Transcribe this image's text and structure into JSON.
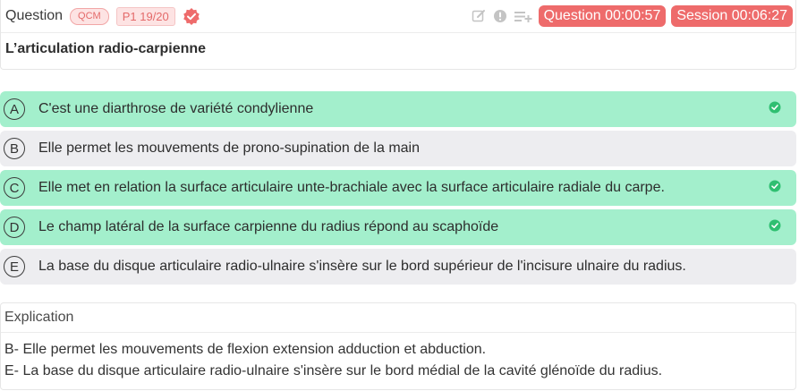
{
  "header": {
    "question_label": "Question",
    "type_badge": "QCM",
    "page_badge": "P1 19/20",
    "question_timer": "Question 00:00:57",
    "session_timer": "Session 00:06:27"
  },
  "question": {
    "title": "L’articulation radio-carpienne"
  },
  "options": [
    {
      "letter": "A",
      "text": "C'est une diarthrose de variété condylienne",
      "correct": true
    },
    {
      "letter": "B",
      "text": "Elle permet les mouvements de prono-supination de la main",
      "correct": false
    },
    {
      "letter": "C",
      "text": "Elle met en relation la surface articulaire unte-brachiale avec la surface articulaire radiale du carpe.",
      "correct": true
    },
    {
      "letter": "D",
      "text": "Le champ latéral de la surface carpienne du radius répond au scaphoïde",
      "correct": true
    },
    {
      "letter": "E",
      "text": "La base du disque articulaire radio-ulnaire s'insère sur le bord supérieur de l'incisure ulnaire du radius.",
      "correct": false
    }
  ],
  "explanation": {
    "heading": "Explication",
    "lines": [
      "B- Elle permet les mouvements de flexion extension adduction et abduction.",
      "E- La base du disque articulaire radio-ulnaire s'insère sur le bord médial de la cavité glénoïde du radius."
    ]
  },
  "colors": {
    "correct_bg": "#a3efcc",
    "neutral_bg": "#ededf0",
    "accent_red": "#ee6b6b",
    "check_green": "#2fbf71"
  },
  "icons": {
    "verified": "verified-badge-icon",
    "edit": "edit-icon",
    "info": "exclamation-circle-icon",
    "add_list": "playlist-add-icon",
    "check": "check-circle-icon"
  }
}
